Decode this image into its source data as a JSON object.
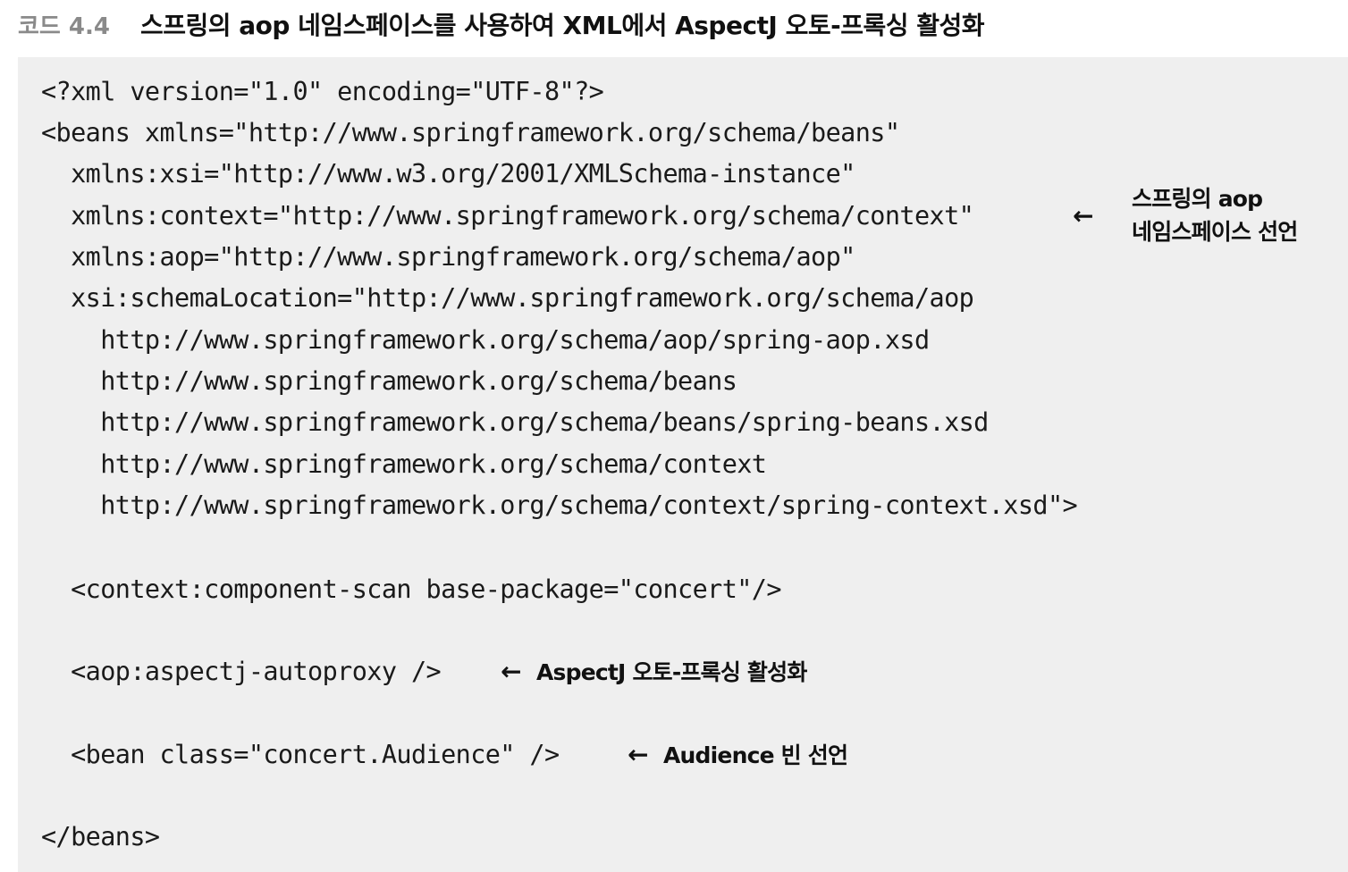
{
  "title": {
    "label": "코드 4.4",
    "text": "스프링의 aop 네임스페이스를 사용하여 XML에서 AspectJ 오토-프록싱 활성화"
  },
  "code": {
    "lines": [
      "<?xml version=\"1.0\" encoding=\"UTF-8\"?>",
      "<beans xmlns=\"http://www.springframework.org/schema/beans\"",
      "  xmlns:xsi=\"http://www.w3.org/2001/XMLSchema-instance\"",
      "  xmlns:context=\"http://www.springframework.org/schema/context\"",
      "  xmlns:aop=\"http://www.springframework.org/schema/aop\"",
      "  xsi:schemaLocation=\"http://www.springframework.org/schema/aop",
      "    http://www.springframework.org/schema/aop/spring-aop.xsd",
      "    http://www.springframework.org/schema/beans",
      "    http://www.springframework.org/schema/beans/spring-beans.xsd",
      "    http://www.springframework.org/schema/context",
      "    http://www.springframework.org/schema/context/spring-context.xsd\">",
      "  <context:component-scan base-package=\"concert\"/>",
      "  <aop:aspectj-autoproxy />",
      "  <bean class=\"concert.Audience\" />",
      "</beans>"
    ]
  },
  "annotations": {
    "arrow": "←",
    "namespace_line1": "스프링의 aop",
    "namespace_line2": "네임스페이스 선언",
    "autoproxy": "AspectJ 오토-프록싱 활성화",
    "audience": "Audience 빈 선언"
  }
}
